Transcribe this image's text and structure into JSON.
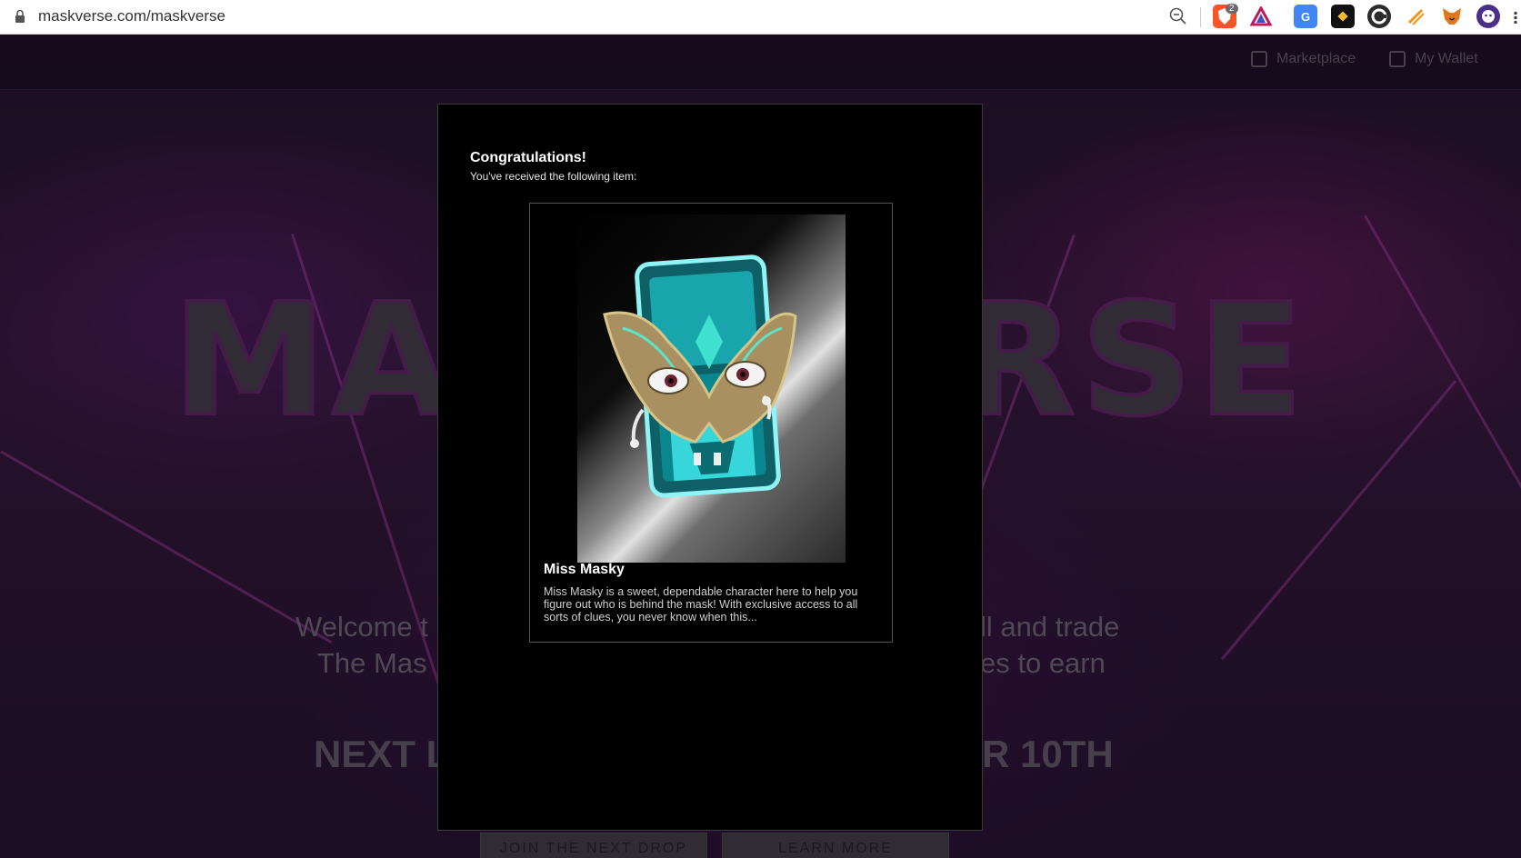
{
  "browser": {
    "url": "maskverse.com/maskverse",
    "extensions": [
      "zoom-icon",
      "brave-shield-icon",
      "brave-rewards-icon",
      "translate-icon",
      "binance-icon",
      "chrome-extension-icon",
      "metamask-fox-icon",
      "avatar-extension-icon"
    ],
    "shield_count": "2"
  },
  "nav": {
    "marketplace": "Marketplace",
    "wallet": "My Wallet"
  },
  "background": {
    "title_left": "MA",
    "title_right": "RSE",
    "welcome_left_1": "Welcome t",
    "welcome_left_2": "The Mas",
    "welcome_right_1": "ll and trade",
    "welcome_right_2": "es to earn",
    "next_left": "NEXT L",
    "next_right": "R 10TH",
    "join_button": "JOIN THE NEXT DROP",
    "learn_button": "LEARN MORE"
  },
  "modal": {
    "title": "Congratulations!",
    "subtitle": "You've received the following item:",
    "item": {
      "name": "Miss Masky",
      "description": "Miss Masky is a sweet, dependable character here to help you figure out who is behind the mask! With exclusive access to all sorts of clues, you never know when this..."
    }
  },
  "colors": {
    "accent": "#2fd3d6",
    "mask_gold": "#b89a5a",
    "page_purple": "#3a1c44"
  }
}
